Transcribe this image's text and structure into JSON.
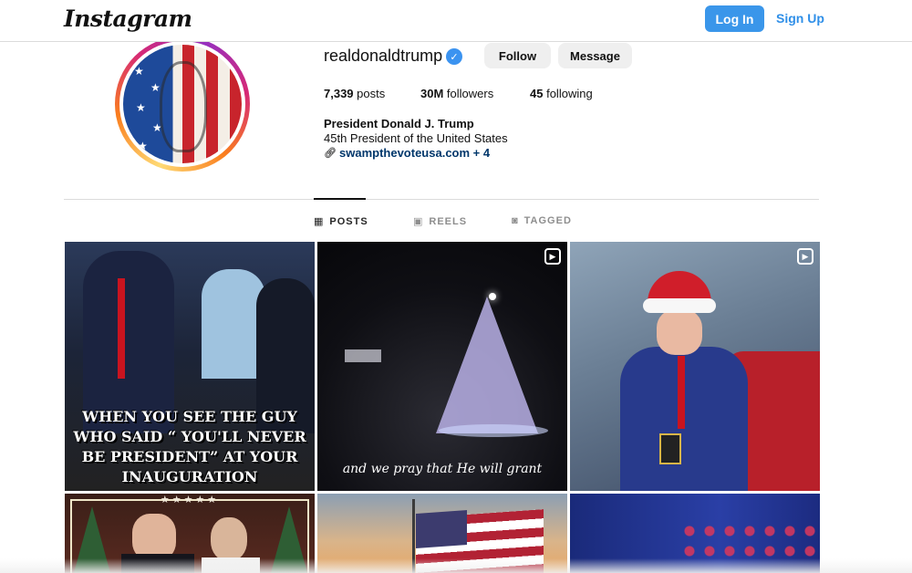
{
  "nav": {
    "logo": "Instagram",
    "login_label": "Log In",
    "signup_label": "Sign Up",
    "accent": "#3a96ea"
  },
  "profile": {
    "username": "realdonaldtrump",
    "verified": true,
    "follow_label": "Follow",
    "message_label": "Message",
    "stats": {
      "posts_count": "7,339",
      "posts_label": "posts",
      "followers_count": "30M",
      "followers_label": "followers",
      "following_count": "45",
      "following_label": "following"
    },
    "bio_name": "President Donald J. Trump",
    "bio_line": "45th President of the United States",
    "bio_link": "swampthevoteusa.com + 4",
    "link_color": "#00376b"
  },
  "tabs": [
    {
      "label": "POSTS",
      "icon": "grid-icon",
      "active": true
    },
    {
      "label": "REELS",
      "icon": "reels-icon",
      "active": false
    },
    {
      "label": "TAGGED",
      "icon": "tagged-icon",
      "active": false
    }
  ],
  "grid": [
    {
      "type": "image",
      "caption": "WHEN YOU SEE THE GUY WHO SAID “ YOU'LL NEVER BE PRESIDENT” AT YOUR INAUGURATION"
    },
    {
      "type": "reel",
      "caption": "and we pray that He will grant"
    },
    {
      "type": "reel",
      "caption": ""
    },
    {
      "type": "image",
      "caption": ""
    },
    {
      "type": "image",
      "caption": ""
    },
    {
      "type": "image",
      "caption": ""
    }
  ]
}
